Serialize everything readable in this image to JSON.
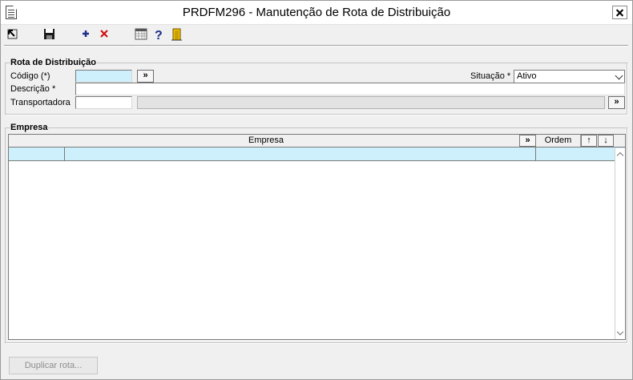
{
  "window": {
    "title": "PRDFM296 - Manutenção de Rota de Distribuição"
  },
  "toolbar": {
    "buttons": [
      {
        "name": "exit-icon",
        "tooltip": ""
      },
      {
        "name": "save-icon",
        "tooltip": ""
      },
      {
        "name": "add-icon",
        "tooltip": ""
      },
      {
        "name": "delete-icon",
        "tooltip": ""
      },
      {
        "name": "calendar-icon",
        "tooltip": ""
      },
      {
        "name": "help-icon",
        "tooltip": ""
      },
      {
        "name": "door-exit-icon",
        "tooltip": ""
      }
    ]
  },
  "rota": {
    "legend": "Rota de Distribuição",
    "codigo_label": "Código (*)",
    "codigo_value": "",
    "codigo_lookup": "»",
    "situacao_label": "Situação *",
    "situacao_value": "Ativo",
    "descricao_label": "Descrição *",
    "descricao_value": "",
    "transportadora_label": "Transportadora",
    "transportadora_code": "",
    "transportadora_name": "",
    "transportadora_lookup": "»"
  },
  "empresa": {
    "legend": "Empresa",
    "columns": {
      "empresa": "Empresa",
      "lookup": "»",
      "ordem": "Ordem",
      "up": "↑",
      "down": "↓"
    },
    "rows": [
      {
        "codigo": "",
        "empresa": "",
        "ordem": ""
      }
    ]
  },
  "footer": {
    "duplicar_label": "Duplicar rota..."
  },
  "colors": {
    "focus_field": "#cdf0fc",
    "window_bg": "#f0f0f0"
  }
}
